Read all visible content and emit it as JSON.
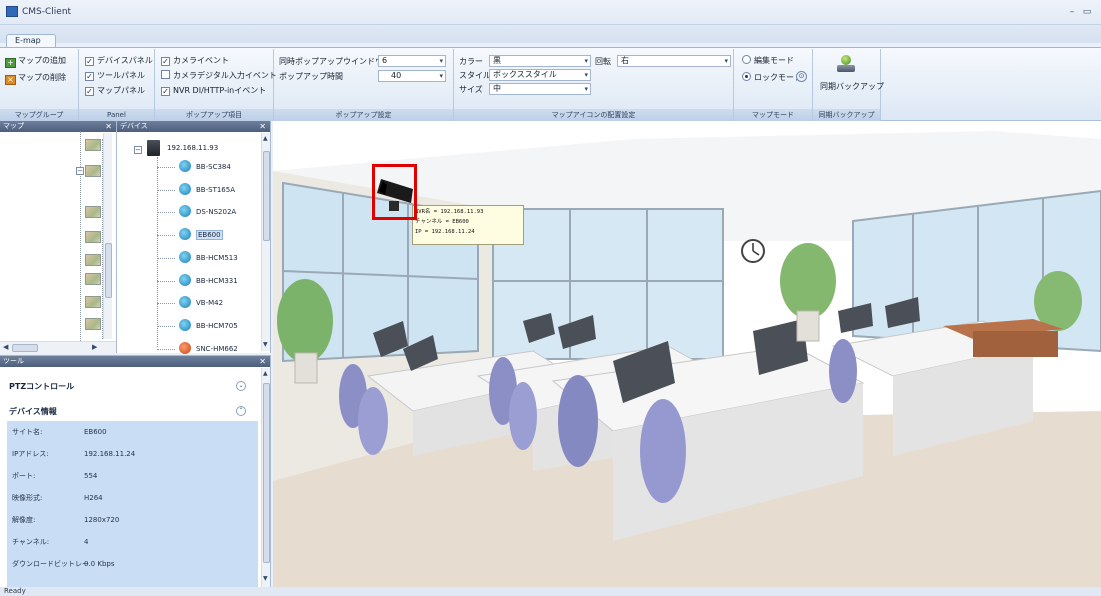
{
  "window": {
    "title": "CMS-Client"
  },
  "tabs": [
    {
      "label": "E-map"
    }
  ],
  "ribbon": {
    "map_group": {
      "add": "マップの追加",
      "delete": "マップの削除",
      "label": "マップグループ"
    },
    "panel_group": {
      "items": [
        {
          "label": "デバイスパネル",
          "checked": true
        },
        {
          "label": "ツールパネル",
          "checked": true
        },
        {
          "label": "マップパネル",
          "checked": true
        }
      ],
      "label": "Panel"
    },
    "popup_items": {
      "items": [
        {
          "label": "カメライベント",
          "checked": true
        },
        {
          "label": "カメラデジタル入力イベント",
          "checked": false
        },
        {
          "label": "NVR DI/HTTP-inイベント",
          "checked": true
        }
      ],
      "label": "ポップアップ項目"
    },
    "popup_settings": {
      "count_label": "同時ポップアップウインドウ数",
      "count_value": "6",
      "time_label": "ポップアップ時間",
      "time_value": "40",
      "label": "ポップアップ設定"
    },
    "icon_settings": {
      "color_label": "カラー",
      "color_value": "黒",
      "rotate_label": "回転",
      "rotate_value": "右",
      "style_label": "スタイル",
      "style_value": "ボックススタイル",
      "size_label": "サイズ",
      "size_value": "中",
      "label": "マップアイコンの配置設定"
    },
    "map_mode": {
      "edit": "編集モード",
      "lock": "ロックモード",
      "selected": "lock",
      "label": "マップモード"
    },
    "sync_backup": {
      "button": "同期バックアップ",
      "label": "同期バックアップ"
    }
  },
  "panels": {
    "map": {
      "title": "マップ"
    },
    "device": {
      "title": "デバイス",
      "root_ip": "192.168.11.93",
      "devices": [
        "BB-SC384",
        "BB-ST165A",
        "DS-NS202A",
        "EB600",
        "BB-HCM513",
        "BB-HCM331",
        "VB-M42",
        "BB-HCM705",
        "SNC-HM662"
      ],
      "selected": "EB600"
    },
    "tool": {
      "title": "ツール",
      "ptz_label": "PTZコントロール",
      "info_label": "デバイス情報",
      "info": [
        {
          "key": "サイト名:",
          "value": "EB600"
        },
        {
          "key": "IPアドレス:",
          "value": "192.168.11.24"
        },
        {
          "key": "ポート:",
          "value": "554"
        },
        {
          "key": "映像形式:",
          "value": "H264"
        },
        {
          "key": "解像度:",
          "value": "1280x720"
        },
        {
          "key": "チャンネル:",
          "value": "4"
        },
        {
          "key": "ダウンロードビットレー",
          "value": "0.0 Kbps"
        }
      ]
    }
  },
  "map_tooltip": {
    "lines": [
      "NVR名 = 192.168.11.93",
      "チャンネル = EB600",
      "IP = 192.168.11.24"
    ]
  },
  "status": {
    "text": "Ready"
  },
  "colors": {
    "highlight": "#e00000",
    "panel_header": "#5a6b88",
    "info_bg": "#c9ddf4"
  }
}
